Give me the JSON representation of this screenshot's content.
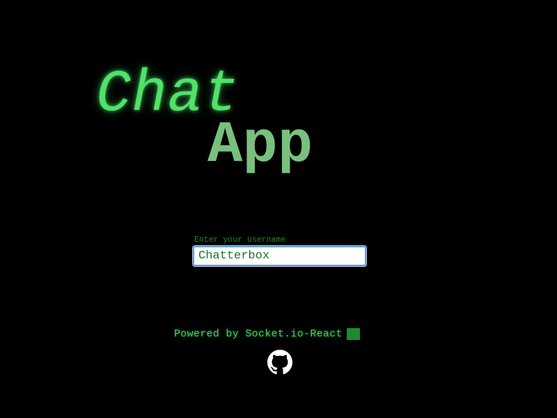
{
  "logo": {
    "line1": "Chat",
    "line2": "App"
  },
  "login": {
    "label": "Enter your username",
    "value": "Chatterbox"
  },
  "footer": {
    "powered_text": "Powered by Socket.io-React",
    "link_icon": "github-icon"
  },
  "colors": {
    "background": "#000000",
    "chat_green": "#4fe36a",
    "app_green": "#79c07f",
    "label_green": "#1f8a2c",
    "input_text": "#157a23",
    "input_border": "#5b9bd5"
  }
}
